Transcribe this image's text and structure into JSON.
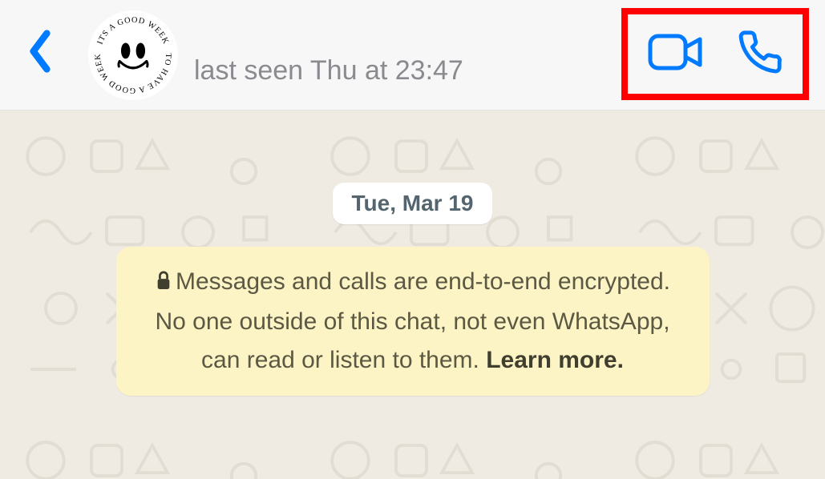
{
  "header": {
    "status": "last seen Thu at 23:47",
    "avatar_text_top": "ITS A GOOD WEEK",
    "avatar_text_bottom": "TO HAVE A GOOD WEEK"
  },
  "chat": {
    "date_label": "Tue, Mar 19",
    "encryption_text": "Messages and calls are end-to-end encrypted. No one outside of this chat, not even WhatsApp, can read or listen to them. ",
    "learn_more": "Learn more."
  },
  "colors": {
    "accent": "#007aff",
    "highlight_box": "#ff0000",
    "chat_bg": "#efeae2",
    "notice_bg": "#fdf4c5"
  }
}
